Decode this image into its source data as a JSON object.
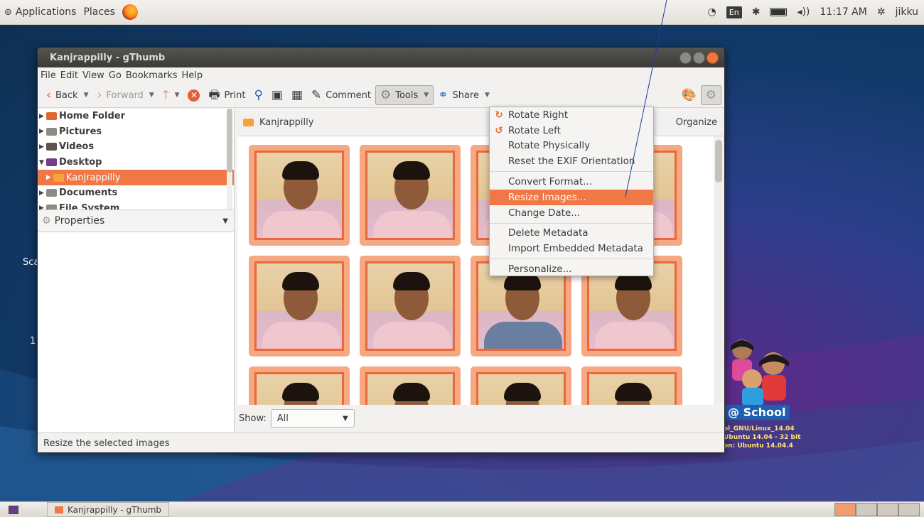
{
  "top_panel": {
    "applications": "Applications",
    "places": "Places",
    "lang": "En",
    "clock": "11:17 AM",
    "user": "jikku"
  },
  "window": {
    "title": "Kanjrappilly - gThumb",
    "menu": [
      "File",
      "Edit",
      "View",
      "Go",
      "Bookmarks",
      "Help"
    ],
    "toolbar": {
      "back": "Back",
      "forward": "Forward",
      "print": "Print",
      "comment": "Comment",
      "tools": "Tools",
      "share": "Share"
    },
    "tree": [
      {
        "label": "Home Folder",
        "color": "#e0662c"
      },
      {
        "label": "Pictures",
        "color": "#8e8a84"
      },
      {
        "label": "Videos",
        "color": "#5a5550"
      },
      {
        "label": "Desktop",
        "color": "#7a3a8a"
      },
      {
        "label": "Kanjrappilly",
        "color": "#f7a23a"
      },
      {
        "label": "Documents",
        "color": "#8e8a84"
      },
      {
        "label": "File System",
        "color": "#8e8a84"
      }
    ],
    "properties_label": "Properties",
    "location": "Kanjrappilly",
    "organize": "Organize",
    "show_label": "Show:",
    "show_value": "All",
    "status": "Resize the selected images"
  },
  "tools_menu": [
    {
      "label": "Rotate Right",
      "icon": "rotate-right-icon"
    },
    {
      "label": "Rotate Left",
      "icon": "rotate-left-icon"
    },
    {
      "label": "Rotate Physically"
    },
    {
      "label": "Reset the EXIF Orientation"
    },
    {
      "label": "Convert Format..."
    },
    {
      "label": "Resize Images..."
    },
    {
      "label": "Change Date..."
    },
    {
      "label": "Delete Metadata"
    },
    {
      "label": "Import Embedded Metadata"
    },
    {
      "label": "Personalize..."
    }
  ],
  "desktop": {
    "left_text_1": "Sca",
    "left_text_2": "1",
    "school_label": "@ School",
    "school_info": [
      "ol_GNU/Linux_14.04",
      "Ubuntu 14.04 - 32 bit",
      "on: Ubuntu 14.04.4"
    ]
  },
  "taskbar": {
    "task": "Kanjrappilly - gThumb"
  },
  "colors": {
    "accent": "#f07746",
    "thumb_border": "#e9693a"
  }
}
